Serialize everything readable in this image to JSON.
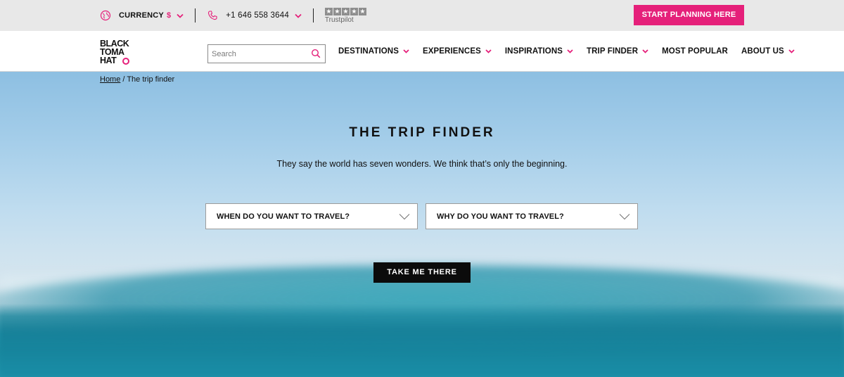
{
  "topbar": {
    "currency_label": "CURRENCY",
    "currency_value": "$",
    "phone": "+1 646 558 3644",
    "trustpilot_label": "Trustpilot",
    "cta_label": "START PLANNING HERE"
  },
  "nav": {
    "logo": {
      "line1": "BLACK",
      "line2": "TOMA",
      "line3": "HAT"
    },
    "search_placeholder": "Search",
    "items": [
      {
        "label": "DESTINATIONS",
        "has_dropdown": true
      },
      {
        "label": "EXPERIENCES",
        "has_dropdown": true
      },
      {
        "label": "INSPIRATIONS",
        "has_dropdown": true
      },
      {
        "label": "TRIP FINDER",
        "has_dropdown": true
      },
      {
        "label": "MOST POPULAR",
        "has_dropdown": false
      },
      {
        "label": "ABOUT US",
        "has_dropdown": true
      }
    ]
  },
  "breadcrumb": {
    "home": "Home",
    "separator": " / ",
    "current": "The trip finder"
  },
  "hero": {
    "title": "THE TRIP FINDER",
    "subtitle": "They say the world has seven wonders. We think that’s only the beginning.",
    "when_select": "WHEN DO YOU WANT TO TRAVEL?",
    "why_select": "WHY DO YOU WANT TO TRAVEL?",
    "submit_label": "TAKE ME THERE"
  },
  "colors": {
    "accent": "#e5207a",
    "topbar_bg": "#e8e8e8",
    "button_dark": "#0b0b0b"
  },
  "icons": {
    "currency": "globe-icon",
    "phone": "phone-icon",
    "search": "search-icon",
    "dropdown": "chevron-down-icon",
    "rating": "star-icon"
  }
}
